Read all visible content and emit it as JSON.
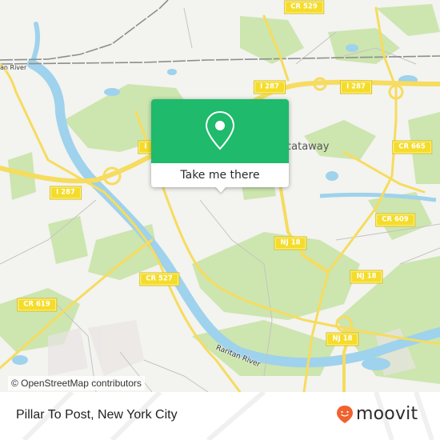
{
  "map": {
    "colors": {
      "background": "#f3f3ef",
      "park": "#c9e4a9",
      "water": "#9fd2ec",
      "road_major": "#f6dc5f",
      "road_minor": "#bdbdbd",
      "rail": "#8e8e8e",
      "shield_bg": "#f5dc2a"
    },
    "road_shields": [
      {
        "id": "cr529",
        "label": "CR 529"
      },
      {
        "id": "i287-a",
        "label": "I 287"
      },
      {
        "id": "i287-b",
        "label": "I 287"
      },
      {
        "id": "i287-c",
        "label": "I 287"
      },
      {
        "id": "i287-d",
        "label": "I"
      },
      {
        "id": "cr665",
        "label": "CR 665"
      },
      {
        "id": "cr609",
        "label": "CR 609"
      },
      {
        "id": "nj18-a",
        "label": "NJ 18"
      },
      {
        "id": "nj18-b",
        "label": "NJ 18"
      },
      {
        "id": "nj18-c",
        "label": "NJ 18"
      },
      {
        "id": "cr527",
        "label": "CR 527"
      },
      {
        "id": "cr619",
        "label": "CR 619"
      }
    ],
    "place_labels": {
      "piscataway": "cataway",
      "raritan_river_top": "an River",
      "raritan_river_bottom": "Raritan River"
    },
    "attribution": "© OpenStreetMap contributors"
  },
  "popup": {
    "icon": "map-pin-icon",
    "action_label": "Take me there",
    "accent_color": "#1fba6b"
  },
  "footer": {
    "place_name": "Pillar To Post, New York City",
    "brand": "moovit",
    "brand_color": "#f0622f"
  }
}
